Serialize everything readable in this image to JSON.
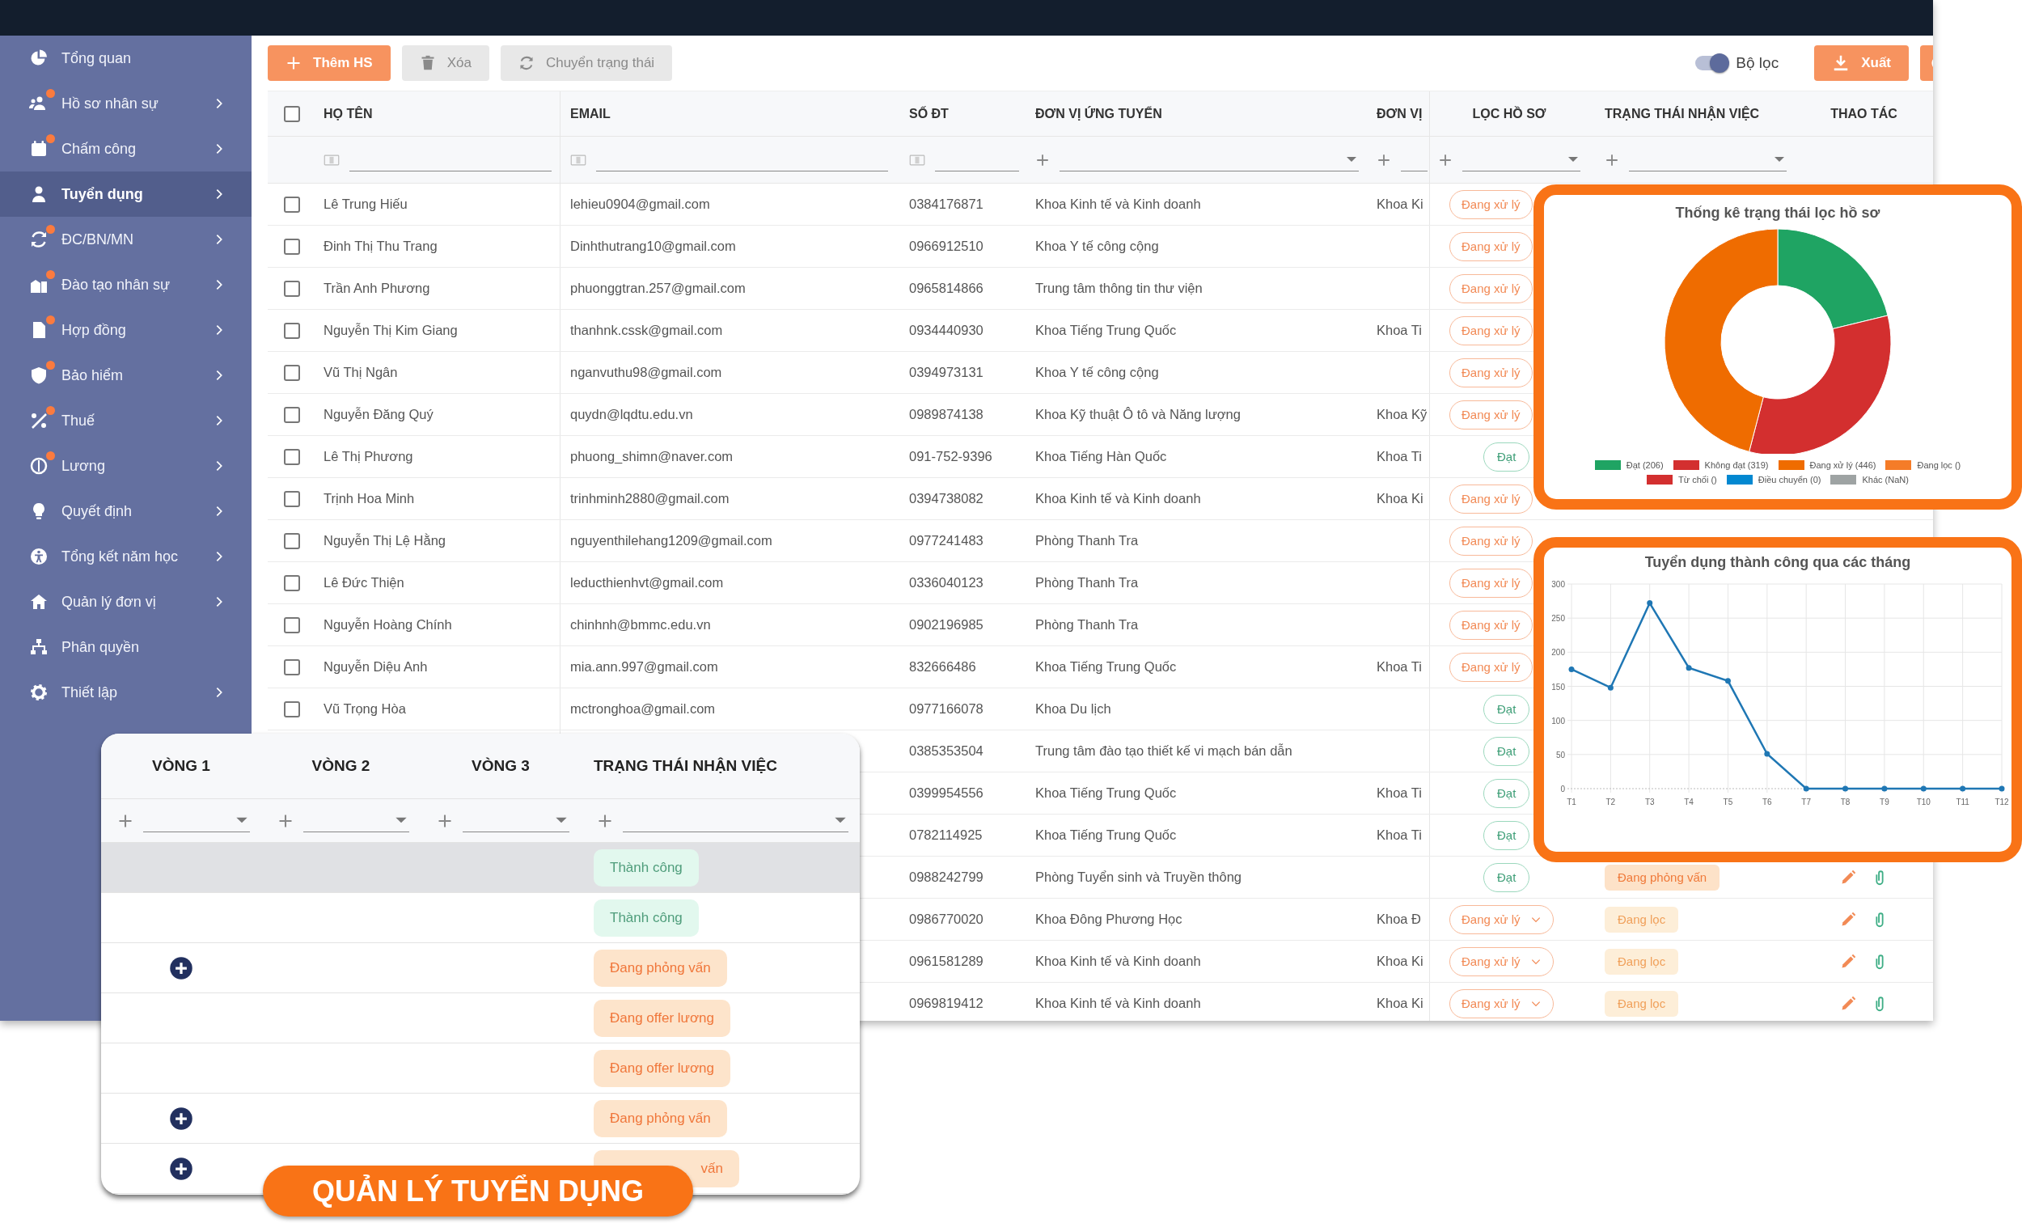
{
  "sidebar": {
    "items": [
      {
        "label": "Tổng quan",
        "selected": false,
        "dot": false,
        "expandable": false
      },
      {
        "label": "Hồ sơ nhân sự",
        "selected": false,
        "dot": true,
        "expandable": true
      },
      {
        "label": "Chấm công",
        "selected": false,
        "dot": true,
        "expandable": true
      },
      {
        "label": "Tuyển dụng",
        "selected": true,
        "dot": false,
        "expandable": true
      },
      {
        "label": "ĐC/BN/MN",
        "selected": false,
        "dot": true,
        "expandable": true
      },
      {
        "label": "Đào tạo nhân sự",
        "selected": false,
        "dot": true,
        "expandable": true
      },
      {
        "label": "Hợp đồng",
        "selected": false,
        "dot": true,
        "expandable": true
      },
      {
        "label": "Bảo hiểm",
        "selected": false,
        "dot": true,
        "expandable": true
      },
      {
        "label": "Thuế",
        "selected": false,
        "dot": true,
        "expandable": true
      },
      {
        "label": "Lương",
        "selected": false,
        "dot": true,
        "expandable": true
      },
      {
        "label": "Quyết định",
        "selected": false,
        "dot": false,
        "expandable": true
      },
      {
        "label": "Tổng kết năm học",
        "selected": false,
        "dot": false,
        "expandable": true
      },
      {
        "label": "Quản lý đơn vị",
        "selected": false,
        "dot": false,
        "expandable": true
      },
      {
        "label": "Phân quyền",
        "selected": false,
        "dot": false,
        "expandable": false
      },
      {
        "label": "Thiết lập",
        "selected": false,
        "dot": false,
        "expandable": true
      }
    ]
  },
  "toolbar": {
    "buttons": [
      {
        "label": "Thêm HS",
        "kind": "add",
        "disabled": false
      },
      {
        "label": "Xóa",
        "kind": "delete",
        "disabled": true
      },
      {
        "label": "Chuyển trạng thái",
        "kind": "transfer",
        "disabled": true
      }
    ],
    "filter_toggle": {
      "label": "Bộ lọc",
      "on": true
    },
    "export_button": {
      "label": "Xuất"
    }
  },
  "table": {
    "select_all": {
      "checked": false
    },
    "columns": [
      {
        "label": "HỌ TÊN",
        "kind": "text"
      },
      {
        "label": "EMAIL",
        "kind": "text"
      },
      {
        "label": "SỐ ĐT",
        "kind": "text"
      },
      {
        "label": "ĐƠN VỊ ỨNG TUYỂN",
        "kind": "select"
      },
      {
        "label": "ĐƠN VỊ",
        "kind": "add"
      },
      {
        "label": "LỌC HỒ SƠ",
        "kind": "select"
      },
      {
        "label": "TRẠNG THÁI NHẬN VIỆC",
        "kind": "select"
      },
      {
        "label": "THAO TÁC"
      }
    ],
    "rows": [
      {
        "checked": false,
        "name": "Lê Trung Hiếu",
        "email": "lehieu0904@gmail.com",
        "phone": "0384176871",
        "unit": "Khoa Kinh tế và Kinh doanh",
        "unit_short": "Khoa Ki",
        "screening": {
          "label": "Đang xử lý",
          "kind": "processing",
          "dropdown": false
        }
      },
      {
        "checked": false,
        "name": "Đinh Thị Thu Trang",
        "email": "Dinhthutrang10@gmail.com",
        "phone": "0966912510",
        "unit": "Khoa Y tế công cộng",
        "screening": {
          "label": "Đang xử lý",
          "kind": "processing",
          "dropdown": false
        }
      },
      {
        "checked": false,
        "name": "Trần Anh Phương",
        "email": "phuonggtran.257@gmail.com",
        "phone": "0965814866",
        "unit": "Trung tâm thông tin thư viện",
        "screening": {
          "label": "Đang xử lý",
          "kind": "processing",
          "dropdown": false
        }
      },
      {
        "checked": false,
        "name": "Nguyễn Thị Kim Giang",
        "email": "thanhnk.cssk@gmail.com",
        "phone": "0934440930",
        "unit": "Khoa Tiếng Trung Quốc",
        "unit_short": "Khoa Ti",
        "screening": {
          "label": "Đang xử lý",
          "kind": "processing",
          "dropdown": false
        }
      },
      {
        "checked": false,
        "name": "Vũ Thị Ngân",
        "email": "nganvuthu98@gmail.com",
        "phone": "0394973131",
        "unit": "Khoa Y tế công cộng",
        "screening": {
          "label": "Đang xử lý",
          "kind": "processing",
          "dropdown": false
        }
      },
      {
        "checked": false,
        "name": "Nguyễn Đăng Quý",
        "email": "quydn@lqdtu.edu.vn",
        "phone": "0989874138",
        "unit": "Khoa Kỹ thuật Ô tô và Năng lượng",
        "unit_short": "Khoa Kỹ",
        "screening": {
          "label": "Đang xử lý",
          "kind": "processing",
          "dropdown": false
        }
      },
      {
        "checked": false,
        "name": "Lê Thị Phương",
        "email": "phuong_shimn@naver.com",
        "phone": "091-752-9396",
        "unit": "Khoa Tiếng Hàn Quốc",
        "unit_short": "Khoa Ti",
        "screening": {
          "label": "Đạt",
          "kind": "passed",
          "dropdown": false
        }
      },
      {
        "checked": false,
        "name": "Trịnh Hoa Minh",
        "email": "trinhminh2880@gmail.com",
        "phone": "0394738082",
        "unit": "Khoa Kinh tế và Kinh doanh",
        "unit_short": "Khoa Ki",
        "screening": {
          "label": "Đang xử lý",
          "kind": "processing",
          "dropdown": false
        }
      },
      {
        "checked": false,
        "name": "Nguyễn Thị Lệ Hằng",
        "email": "nguyenthilehang1209@gmail.com",
        "phone": "0977241483",
        "unit": "Phòng Thanh Tra",
        "screening": {
          "label": "Đang xử lý",
          "kind": "processing",
          "dropdown": false
        }
      },
      {
        "checked": false,
        "name": "Lê Đức Thiện",
        "email": "leducthienhvt@gmail.com",
        "phone": "0336040123",
        "unit": "Phòng Thanh Tra",
        "screening": {
          "label": "Đang xử lý",
          "kind": "processing",
          "dropdown": false
        }
      },
      {
        "checked": false,
        "name": "Nguyễn Hoàng Chính",
        "email": "chinhnh@bmmc.edu.vn",
        "phone": "0902196985",
        "unit": "Phòng Thanh Tra",
        "screening": {
          "label": "Đang xử lý",
          "kind": "processing",
          "dropdown": false
        }
      },
      {
        "checked": false,
        "name": "Nguyễn Diệu Anh",
        "email": "mia.ann.997@gmail.com",
        "phone": "832666486",
        "unit": "Khoa Tiếng Trung Quốc",
        "unit_short": "Khoa Ti",
        "screening": {
          "label": "Đang xử lý",
          "kind": "processing",
          "dropdown": false
        }
      },
      {
        "checked": false,
        "name": "Vũ Trọng Hòa",
        "email": "mctronghoa@gmail.com",
        "phone": "0977166078",
        "unit": "Khoa Du lịch",
        "screening": {
          "label": "Đạt",
          "kind": "passed",
          "dropdown": false
        }
      },
      {
        "phone": "0385353504",
        "unit": "Trung tâm đào tạo thiết kế vi mạch bán dẫn",
        "screening": {
          "label": "Đạt",
          "kind": "passed",
          "dropdown": false
        }
      },
      {
        "phone": "0399954556",
        "unit": "Khoa Tiếng Trung Quốc",
        "unit_short": "Khoa Ti",
        "screening": {
          "label": "Đạt",
          "kind": "passed",
          "dropdown": false
        }
      },
      {
        "phone": "0782114925",
        "unit": "Khoa Tiếng Trung Quốc",
        "unit_short": "Khoa Ti",
        "screening": {
          "label": "Đạt",
          "kind": "passed",
          "dropdown": false
        }
      },
      {
        "phone": "0988242799",
        "unit": "Phòng Tuyển sinh và Truyền thông",
        "screening": {
          "label": "Đạt",
          "kind": "passed",
          "dropdown": false
        },
        "status": {
          "label": "Đang phỏng vấn",
          "kind": "interview"
        }
      },
      {
        "phone": "0986770020",
        "unit": "Khoa Đông Phương Học",
        "unit_short": "Khoa Đ",
        "screening": {
          "label": "Đang xử lý",
          "kind": "processing",
          "dropdown": true
        },
        "status": {
          "label": "Đang lọc",
          "kind": "filtering"
        }
      },
      {
        "phone": "0961581289",
        "unit": "Khoa Kinh tế và Kinh doanh",
        "unit_short": "Khoa Ki",
        "screening": {
          "label": "Đang xử lý",
          "kind": "processing",
          "dropdown": true
        },
        "status": {
          "label": "Đang lọc",
          "kind": "filtering"
        }
      },
      {
        "phone": "0969819412",
        "unit": "Khoa Kinh tế và Kinh doanh",
        "unit_short": "Khoa Ki",
        "screening": {
          "label": "Đang xử lý",
          "kind": "processing",
          "dropdown": true
        },
        "status": {
          "label": "Đang lọc",
          "kind": "filtering"
        }
      }
    ]
  },
  "donut_card": {
    "chart_data": {
      "type": "donut",
      "title": "Thống kê trạng thái lọc hồ sơ",
      "categories": [
        "Đạt (206)",
        "Không đạt (319)",
        "Đang xử lý (446)",
        "Đang lọc ()",
        "Từ chối ()",
        "Điều chuyển (0)",
        "Khác (NaN)"
      ],
      "values": [
        206,
        319,
        446,
        null,
        null,
        0,
        null
      ]
    },
    "legend": [
      {
        "color": "#1fa463"
      },
      {
        "color": "#d32f2f"
      },
      {
        "color": "#ef6c00"
      },
      {
        "color": "#f57c28"
      },
      {
        "color": "#d32f2f"
      },
      {
        "color": "#0288d1"
      },
      {
        "color": "#9ea3a3"
      }
    ]
  },
  "line_card": {
    "chart_data": {
      "type": "line",
      "title": "Tuyển dụng thành công qua các tháng",
      "categories": [
        "T1",
        "T2",
        "T3",
        "T4",
        "T5",
        "T6",
        "T7",
        "T8",
        "T9",
        "T10",
        "T11",
        "T12"
      ],
      "series": [
        {
          "color": "#1f77b4",
          "marker": true,
          "values": [
            175,
            148,
            272,
            177,
            158,
            51,
            0,
            0,
            0,
            0,
            0,
            0
          ]
        }
      ],
      "grid": true,
      "ylim": [
        0,
        300
      ],
      "yticks": [
        0,
        50,
        100,
        150,
        200,
        250,
        300
      ]
    }
  },
  "round_panel": {
    "columns": [
      {
        "label": "VÒNG 1"
      },
      {
        "label": "VÒNG 2"
      },
      {
        "label": "VÒNG 3"
      },
      {
        "label": "TRẠNG THÁI NHẬN VIỆC"
      }
    ],
    "rows": [
      {
        "highlighted": true,
        "add_round": false,
        "status": {
          "label": "Thành công",
          "kind": "success",
          "cut": false
        }
      },
      {
        "highlighted": false,
        "add_round": false,
        "status": {
          "label": "Thành công",
          "kind": "success",
          "cut": false
        }
      },
      {
        "highlighted": false,
        "add_round": true,
        "status": {
          "label": "Đang phỏng vấn",
          "kind": "interview",
          "cut": false
        }
      },
      {
        "highlighted": false,
        "add_round": false,
        "status": {
          "label": "Đang offer lương",
          "kind": "interview",
          "cut": false
        }
      },
      {
        "highlighted": false,
        "add_round": false,
        "status": {
          "label": "Đang offer lương",
          "kind": "interview",
          "cut": false
        }
      },
      {
        "highlighted": false,
        "add_round": true,
        "status": {
          "label": "Đang phỏng vấn",
          "kind": "interview",
          "cut": false
        }
      },
      {
        "highlighted": false,
        "add_round": true,
        "status": {
          "label": "vấn",
          "kind": "interview",
          "cut": true
        }
      }
    ]
  },
  "banner": {
    "title": "QUẢN LÝ TUYỂN DỤNG"
  }
}
